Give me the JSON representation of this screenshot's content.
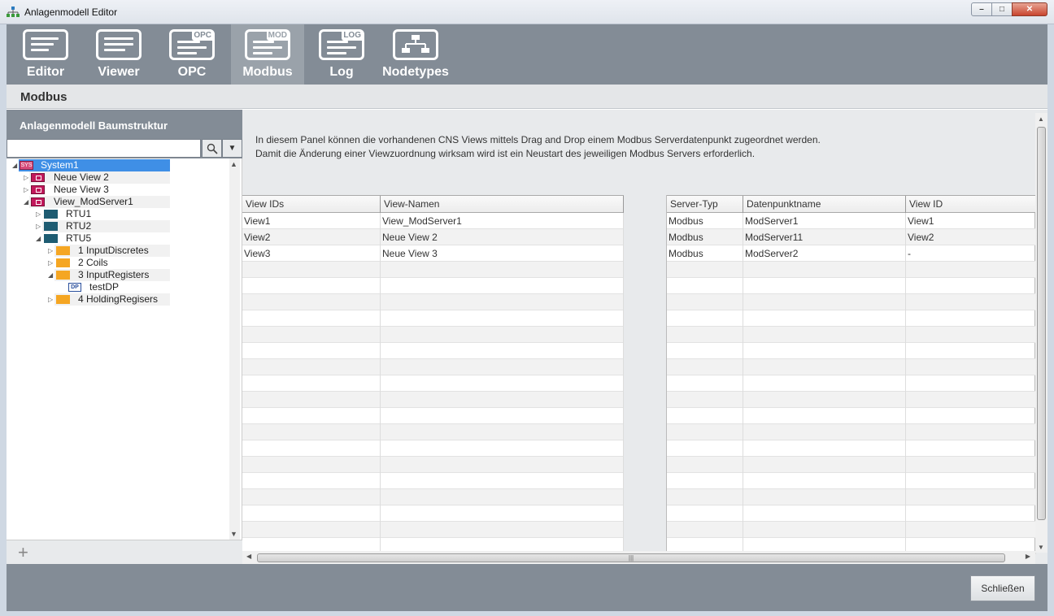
{
  "window": {
    "title": "Anlagenmodell Editor",
    "min_icon": "minimize-icon",
    "max_icon": "maximize-icon",
    "close_icon": "close-icon"
  },
  "toolbar": {
    "items": [
      {
        "label": "Editor",
        "icon": "editor-icon",
        "tag": ""
      },
      {
        "label": "Viewer",
        "icon": "viewer-icon",
        "tag": ""
      },
      {
        "label": "OPC",
        "icon": "opc-icon",
        "tag": "OPC"
      },
      {
        "label": "Modbus",
        "icon": "modbus-icon",
        "tag": "MOD"
      },
      {
        "label": "Log",
        "icon": "log-icon",
        "tag": "LOG"
      },
      {
        "label": "Nodetypes",
        "icon": "nodetypes-icon",
        "tag": ""
      }
    ],
    "active": "Modbus"
  },
  "subheader": {
    "title": "Modbus"
  },
  "left_panel": {
    "title": "Anlagenmodell Baumstruktur",
    "search": {
      "value": "",
      "placeholder": ""
    },
    "tree": [
      {
        "label": "System1",
        "icon": "sys-icon",
        "icon_text": "SYS",
        "selected": true
      },
      {
        "label": "Neue View 2",
        "icon": "view-icon"
      },
      {
        "label": "Neue View 3",
        "icon": "view-icon"
      },
      {
        "label": "View_ModServer1",
        "icon": "view-icon"
      },
      {
        "label": "RTU1",
        "icon": "rtu-icon"
      },
      {
        "label": "RTU2",
        "icon": "rtu-icon"
      },
      {
        "label": "RTU5",
        "icon": "rtu-icon"
      },
      {
        "label": "1 InputDiscretes",
        "icon": "folder-icon"
      },
      {
        "label": "2 Coils",
        "icon": "folder-icon"
      },
      {
        "label": "3 InputRegisters",
        "icon": "folder-icon"
      },
      {
        "label": "testDP",
        "icon": "datapoint-icon",
        "icon_text": "DP"
      },
      {
        "label": "4 HoldingRegisers",
        "icon": "folder-icon"
      }
    ],
    "add_label": "+"
  },
  "main": {
    "description_line1": "In diesem Panel können die vorhandenen CNS Views mittels Drag and Drop einem Modbus Serverdatenpunkt zugeordnet werden.",
    "description_line2": "Damit die Änderung einer Viewzuordnung wirksam wird ist ein Neustart des jeweiligen Modbus Servers erforderlich.",
    "views_table": {
      "columns": [
        "View IDs",
        "View-Namen"
      ],
      "rows": [
        [
          "View1",
          "View_ModServer1"
        ],
        [
          "View2",
          "Neue View 2"
        ],
        [
          "View3",
          "Neue View 3"
        ]
      ]
    },
    "server_table": {
      "columns": [
        "Server-Typ",
        "Datenpunktname",
        "View ID"
      ],
      "rows": [
        [
          "Modbus",
          "ModServer1",
          "View1"
        ],
        [
          "Modbus",
          "ModServer11",
          "View2"
        ],
        [
          "Modbus",
          "ModServer2",
          "-"
        ]
      ]
    }
  },
  "footer": {
    "close_label": "Schließen"
  }
}
